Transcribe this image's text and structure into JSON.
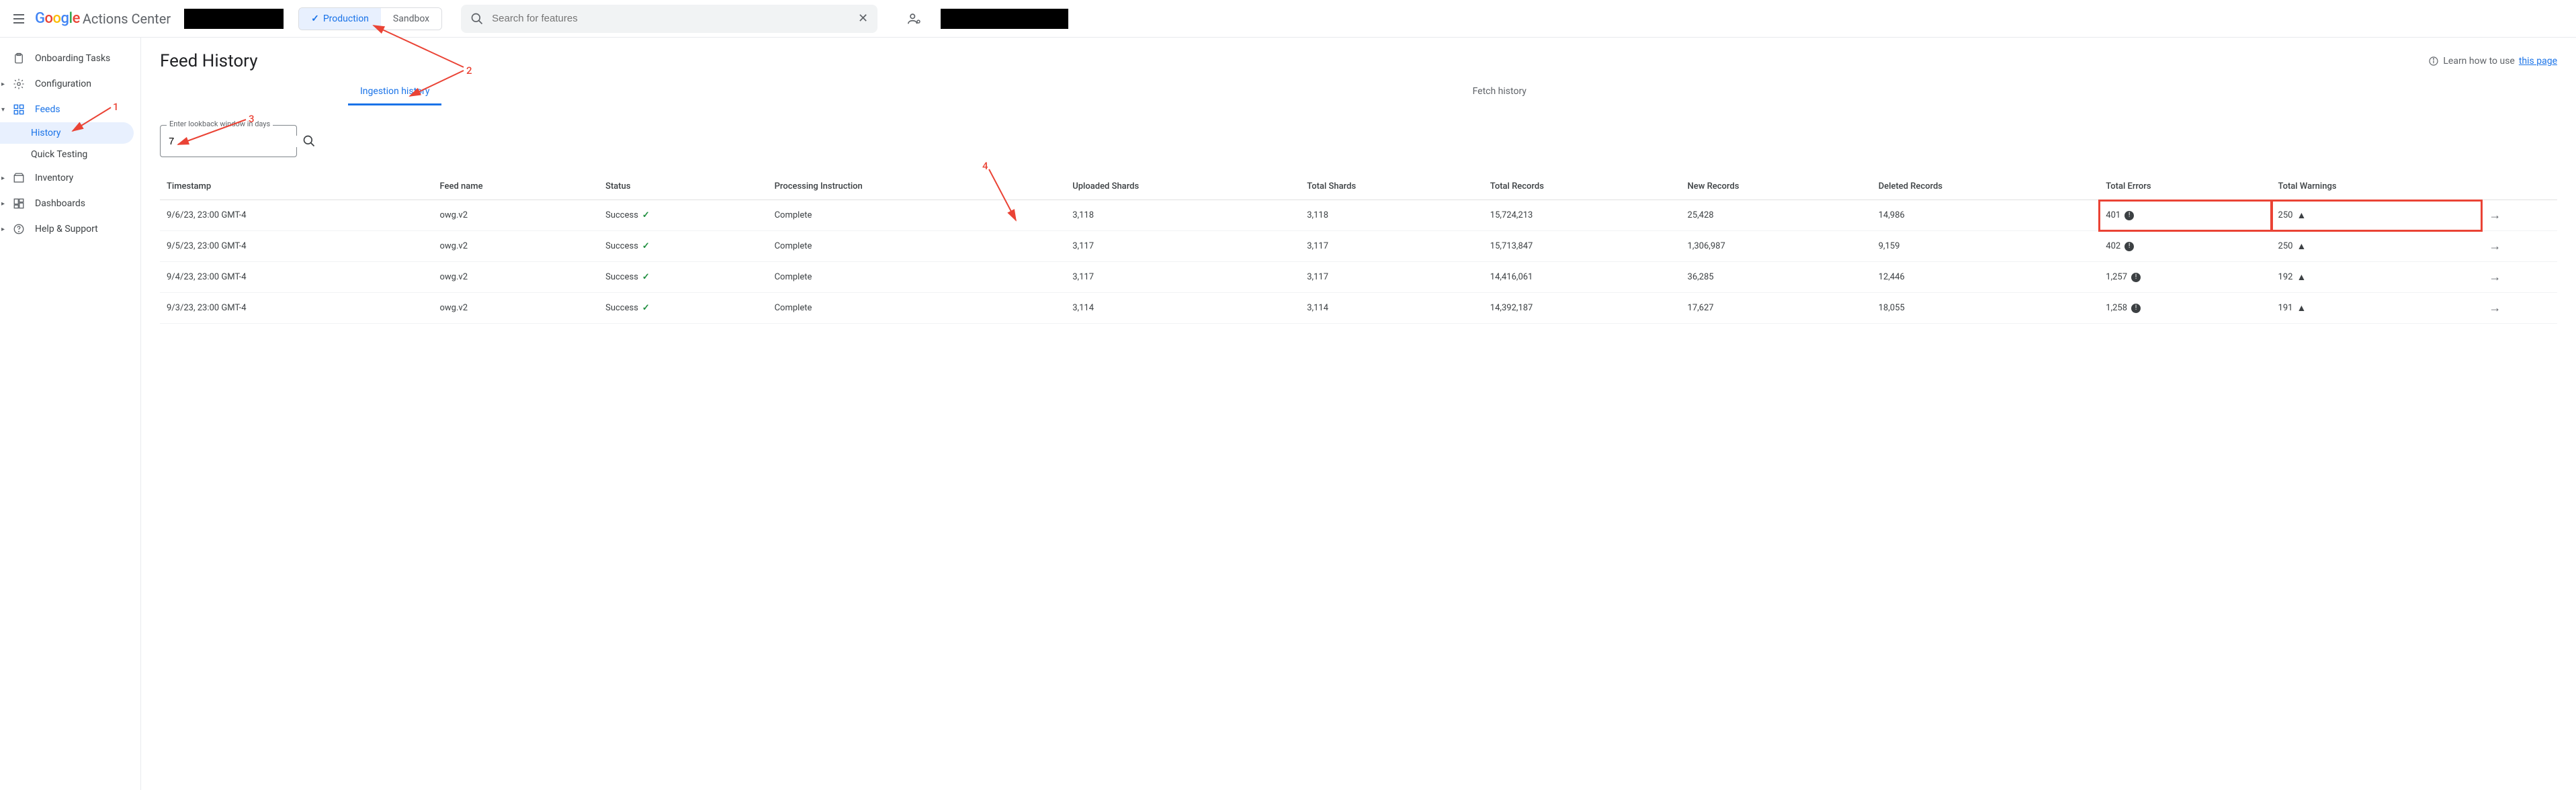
{
  "header": {
    "product_name": "Actions Center",
    "env_production": "Production",
    "env_sandbox": "Sandbox",
    "search_placeholder": "Search for features"
  },
  "sidebar": {
    "onboarding": "Onboarding Tasks",
    "configuration": "Configuration",
    "feeds": "Feeds",
    "history": "History",
    "quick_testing": "Quick Testing",
    "inventory": "Inventory",
    "dashboards": "Dashboards",
    "help": "Help & Support"
  },
  "page": {
    "title": "Feed History",
    "learn_prefix": "Learn how to use ",
    "learn_link": "this page",
    "tab_ingestion": "Ingestion history",
    "tab_fetch": "Fetch history",
    "lookback_label": "Enter lookback window in days",
    "lookback_value": "7"
  },
  "table": {
    "headers": {
      "timestamp": "Timestamp",
      "feed_name": "Feed name",
      "status": "Status",
      "processing": "Processing Instruction",
      "uploaded_shards": "Uploaded Shards",
      "total_shards": "Total Shards",
      "total_records": "Total Records",
      "new_records": "New Records",
      "deleted_records": "Deleted Records",
      "total_errors": "Total Errors",
      "total_warnings": "Total Warnings"
    },
    "rows": [
      {
        "timestamp": "9/6/23, 23:00 GMT-4",
        "feed": "owg.v2",
        "status": "Success",
        "proc": "Complete",
        "ush": "3,118",
        "tsh": "3,118",
        "trec": "15,724,213",
        "nrec": "25,428",
        "drec": "14,986",
        "terr": "401",
        "twarn": "250",
        "highlight": true
      },
      {
        "timestamp": "9/5/23, 23:00 GMT-4",
        "feed": "owg.v2",
        "status": "Success",
        "proc": "Complete",
        "ush": "3,117",
        "tsh": "3,117",
        "trec": "15,713,847",
        "nrec": "1,306,987",
        "drec": "9,159",
        "terr": "402",
        "twarn": "250",
        "highlight": false
      },
      {
        "timestamp": "9/4/23, 23:00 GMT-4",
        "feed": "owg.v2",
        "status": "Success",
        "proc": "Complete",
        "ush": "3,117",
        "tsh": "3,117",
        "trec": "14,416,061",
        "nrec": "36,285",
        "drec": "12,446",
        "terr": "1,257",
        "twarn": "192",
        "highlight": false
      },
      {
        "timestamp": "9/3/23, 23:00 GMT-4",
        "feed": "owg.v2",
        "status": "Success",
        "proc": "Complete",
        "ush": "3,114",
        "tsh": "3,114",
        "trec": "14,392,187",
        "nrec": "17,627",
        "drec": "18,055",
        "terr": "1,258",
        "twarn": "191",
        "highlight": false
      }
    ]
  },
  "annotations": {
    "a1": "1",
    "a2": "2",
    "a3": "3",
    "a4": "4"
  }
}
